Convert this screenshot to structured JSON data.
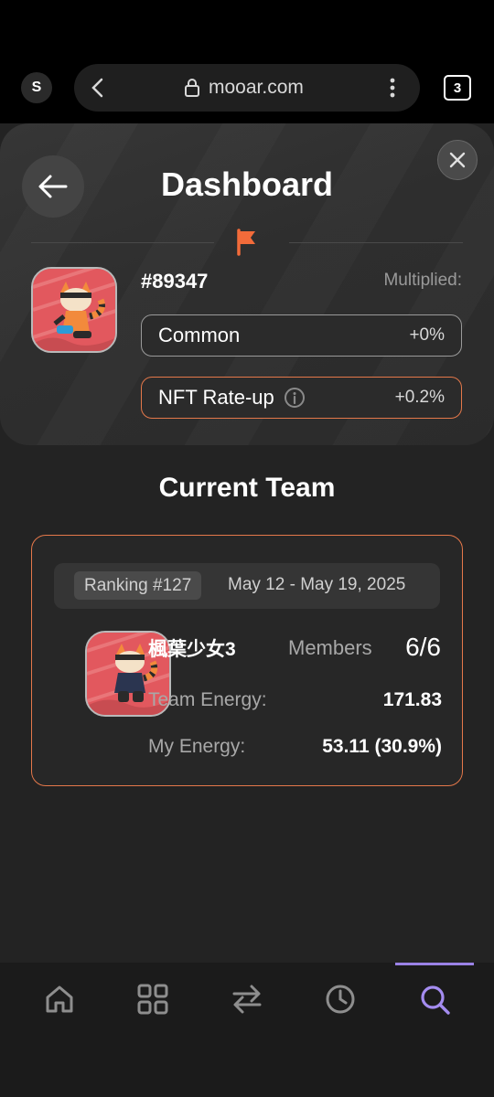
{
  "browser": {
    "profile_initial": "S",
    "url": "mooar.com",
    "tab_count": "3"
  },
  "header": {
    "title": "Dashboard"
  },
  "nft": {
    "id": "#89347",
    "multiplied_label": "Multiplied:",
    "rarity_label": "Common",
    "rarity_value": "+0%",
    "rateup_label": "NFT Rate-up",
    "rateup_value": "+0.2%"
  },
  "team": {
    "section_title": "Current Team",
    "ranking": "Ranking #127",
    "date_range": "May 12 - May 19, 2025",
    "name": "楓葉少女3",
    "members_label": "Members",
    "members_value": "6/6",
    "team_energy_label": "Team Energy:",
    "team_energy_value": "171.83",
    "my_energy_label": "My Energy:",
    "my_energy_value": "53.11 (30.9%)"
  },
  "nav": {
    "items": [
      "home-icon",
      "grid-icon",
      "swap-icon",
      "clock-icon",
      "search-icon"
    ],
    "active": "search-icon"
  },
  "colors": {
    "accent": "#e4784a",
    "nav_active": "#9a82e6",
    "avatar_bg": "#e2585e"
  }
}
